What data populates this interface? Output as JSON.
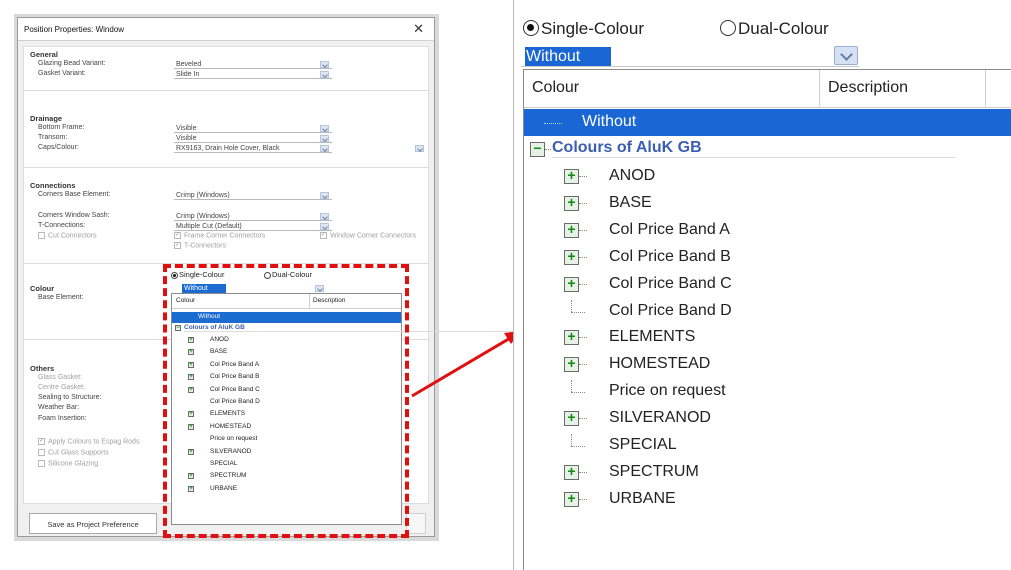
{
  "dialog": {
    "title": "Position Properties: Window",
    "close": "✕",
    "general": {
      "title": "General",
      "rows": [
        {
          "label": "Glazing Bead Variant:",
          "value": "Beveled"
        },
        {
          "label": "Gasket Variant:",
          "value": "Slide In"
        }
      ]
    },
    "drainage": {
      "title": "Drainage",
      "rows": [
        {
          "label": "Bottom Frame:",
          "value": "Visible"
        },
        {
          "label": "Transom:",
          "value": "Visible"
        },
        {
          "label": "Caps/Colour:",
          "value": "RX9163, Drain Hole Cover, Black"
        }
      ]
    },
    "connections": {
      "title": "Connections",
      "rows": [
        {
          "label": "Corners Base Element:",
          "value": "Crimp (Windows)"
        },
        {
          "label": "Corners Window Sash:",
          "value": "Crimp (Windows)"
        },
        {
          "label": "T-Connections:",
          "value": "Multiple Cut (Default)"
        }
      ],
      "cut_connectors": "Cut Connectors",
      "frame_corner": "Frame Corner Connectors",
      "window_corner": "Window Corner Connectors",
      "t_connectors": "T-Connectors"
    },
    "colour": {
      "title": "Colour",
      "base_label": "Base Element:"
    },
    "others": {
      "title": "Others",
      "rows": [
        "Glass Gasket:",
        "Centre Gasket:",
        "Sealing to Structure:",
        "Weather Bar:",
        "Foam Insertion:"
      ],
      "checks": [
        "Apply Colours to Espag Rods",
        "Cut Glass Supports",
        "Silicone Glazing"
      ]
    },
    "save_pref": "Save as Project Preference"
  },
  "colour_picker": {
    "single": "Single-Colour",
    "dual": "Dual-Colour",
    "selected_value": "Without",
    "col_colour": "Colour",
    "col_description": "Description",
    "without_item": "Without",
    "group": "Colours of AluK GB",
    "items": [
      {
        "label": "ANOD",
        "expandable": true
      },
      {
        "label": "BASE",
        "expandable": true
      },
      {
        "label": "Col Price Band A",
        "expandable": true
      },
      {
        "label": "Col Price Band B",
        "expandable": true
      },
      {
        "label": "Col Price Band C",
        "expandable": true
      },
      {
        "label": "Col Price Band D",
        "expandable": false
      },
      {
        "label": "ELEMENTS",
        "expandable": true
      },
      {
        "label": "HOMESTEAD",
        "expandable": true
      },
      {
        "label": "Price on request",
        "expandable": false
      },
      {
        "label": "SILVERANOD",
        "expandable": true
      },
      {
        "label": "SPECIAL",
        "expandable": false
      },
      {
        "label": "SPECTRUM",
        "expandable": true
      },
      {
        "label": "URBANE",
        "expandable": true
      }
    ]
  },
  "colors": {
    "highlight": "#1a66d4",
    "group_text": "#3a5fb0",
    "annotation": "#e01010"
  },
  "icons": {
    "expand": "plus-box-icon",
    "collapse": "minus-box-icon",
    "close": "close-icon",
    "dropdown": "chevron-down-icon"
  }
}
